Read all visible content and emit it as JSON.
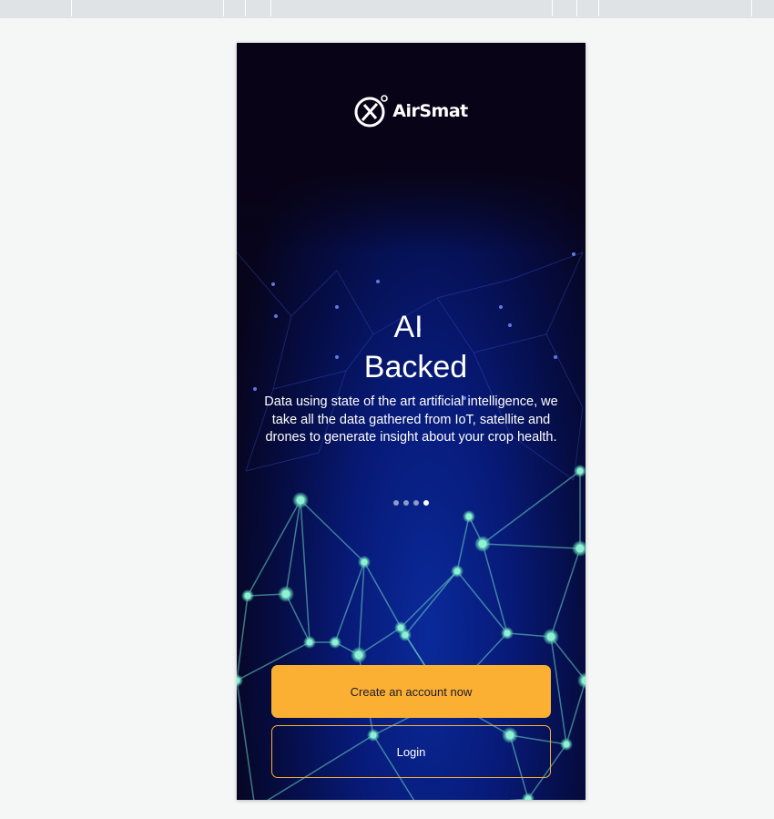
{
  "brand": {
    "name": "AirSmat",
    "logo_icon": "airsmat-logo-icon"
  },
  "slide": {
    "title_line1": "AI",
    "title_line2": "Backed",
    "description": "Data using state of the art artificial intelligence, we take all the data gathered from IoT, satellite and drones to generate insight about your crop health.",
    "total_slides": 4,
    "active_slide": 4
  },
  "actions": {
    "create_account_label": "Create an account now",
    "login_label": "Login"
  },
  "colors": {
    "accent": "#fcb033",
    "background_dark": "#07041c",
    "network_glow": "#2f6bff",
    "node_teal": "#5fd3b5"
  }
}
